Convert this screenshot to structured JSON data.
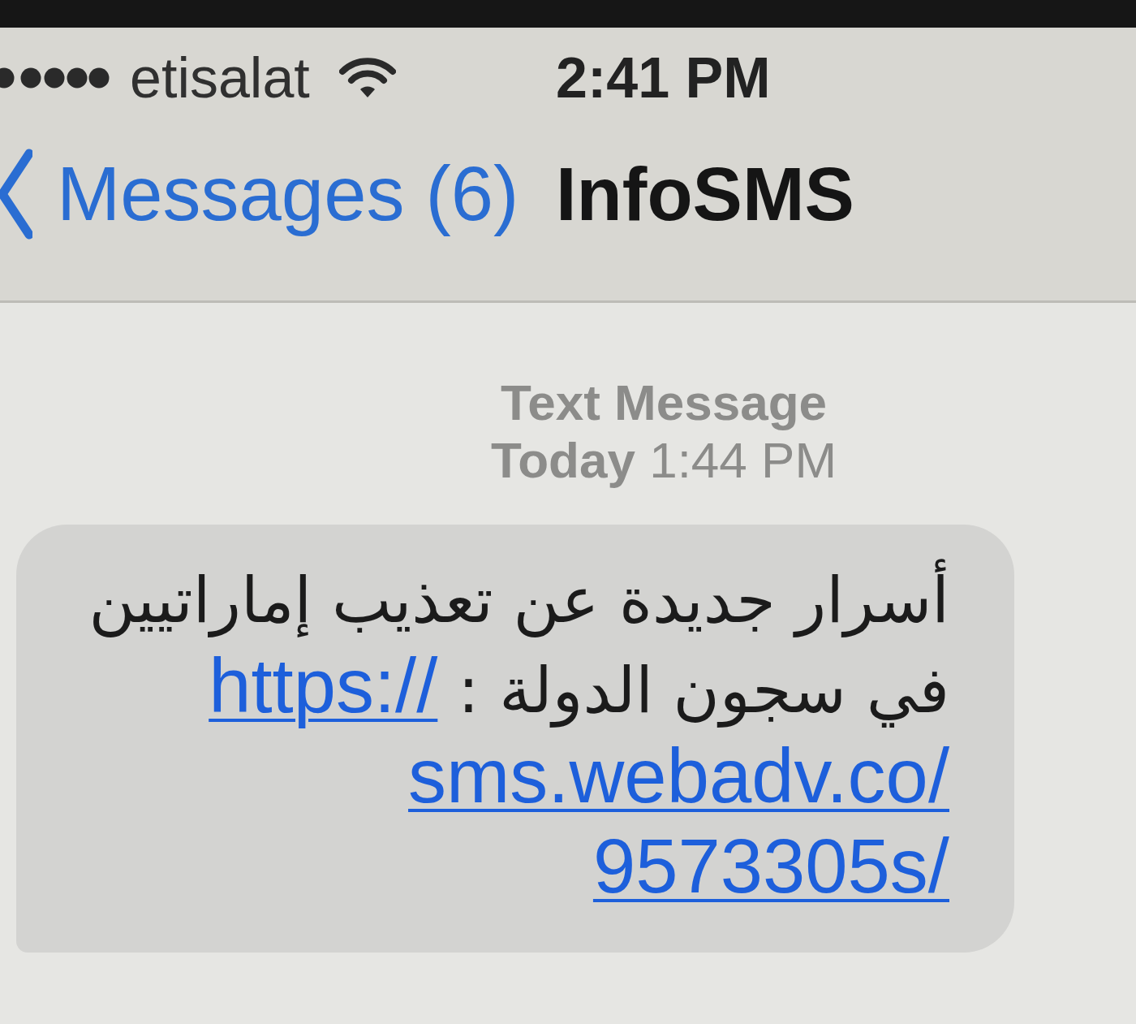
{
  "status_bar": {
    "carrier": "etisalat",
    "time": "2:41 PM"
  },
  "nav_bar": {
    "back_label": "Messages (6)",
    "title": "InfoSMS"
  },
  "thread": {
    "header": {
      "label": "Text Message",
      "timestamp": "**Today** 1:44 PM"
    },
    "messages": [
      {
        "kind": "received",
        "text_lines": [
          "أسرار جديدة عن تعذيب إماراتيين",
          "في سجون الدولة :"
        ],
        "link_lines": [
          "https://",
          "sms.webadv.co/",
          "9573305s/"
        ]
      }
    ]
  }
}
